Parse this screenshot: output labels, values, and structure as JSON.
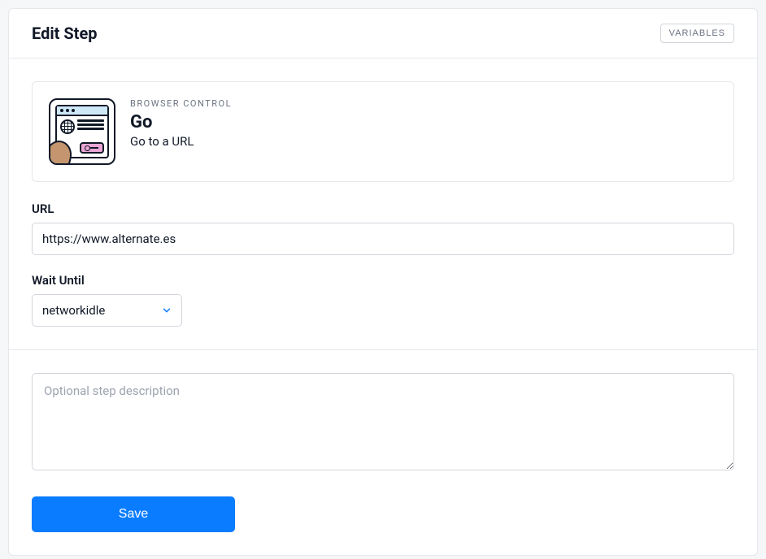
{
  "header": {
    "title": "Edit Step",
    "variables_btn": "VARIABLES"
  },
  "step": {
    "category": "BROWSER CONTROL",
    "name": "Go",
    "description": "Go to a URL"
  },
  "fields": {
    "url": {
      "label": "URL",
      "value": "https://www.alternate.es"
    },
    "wait_until": {
      "label": "Wait Until",
      "value": "networkidle"
    },
    "description": {
      "placeholder": "Optional step description",
      "value": ""
    }
  },
  "actions": {
    "save": "Save"
  }
}
